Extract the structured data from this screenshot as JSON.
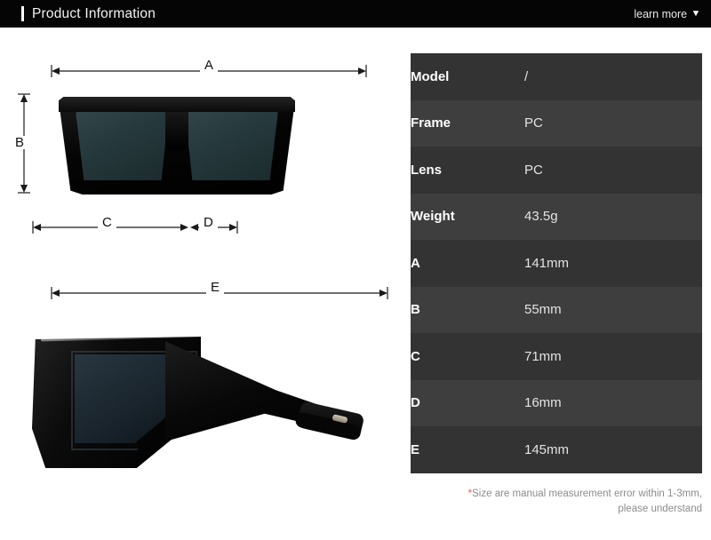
{
  "header": {
    "title": "Product Information",
    "learn_more_label": "learn more",
    "caret_glyph": "▼",
    "background_color": "#050505",
    "accent_color": "#ffffff"
  },
  "diagram": {
    "front_view": {
      "name": "sunglasses-front-view",
      "dimension_labels": {
        "a": "A",
        "b": "B",
        "c": "C",
        "d": "D"
      }
    },
    "side_view": {
      "name": "sunglasses-side-view",
      "dimension_labels": {
        "e": "E"
      }
    },
    "lens_color": "#26393c",
    "frame_color": "#0a0a0a",
    "line_color": "#1a1a1a"
  },
  "spec_table": {
    "row_color_odd": "#333333",
    "row_color_even": "#3e3e3e",
    "rows": [
      {
        "label": "Model",
        "value": "/"
      },
      {
        "label": "Frame",
        "value": "PC"
      },
      {
        "label": "Lens",
        "value": "PC"
      },
      {
        "label": "Weight",
        "value": "43.5g"
      },
      {
        "label": "A",
        "value": "141mm"
      },
      {
        "label": "B",
        "value": "55mm"
      },
      {
        "label": "C",
        "value": "71mm"
      },
      {
        "label": "D",
        "value": "16mm"
      },
      {
        "label": "E",
        "value": "145mm"
      }
    ],
    "footnote": {
      "star": "*",
      "line1": "Size are manual measurement error within 1-3mm,",
      "line2": "please understand",
      "star_color": "#e8565a",
      "text_color": "#8c8c8c"
    }
  }
}
